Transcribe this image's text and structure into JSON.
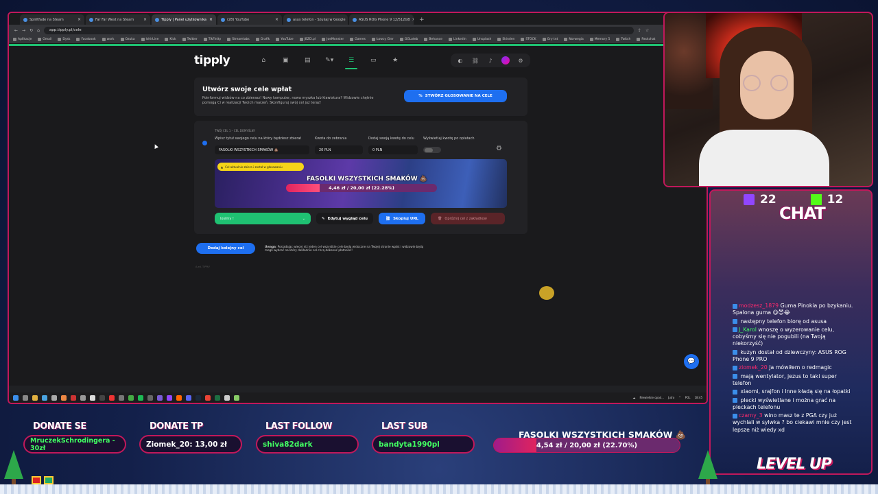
{
  "browser": {
    "tabs": [
      {
        "label": "Spiritfade na Steam",
        "active": false
      },
      {
        "label": "Far Far West na Steam",
        "active": false
      },
      {
        "label": "Tipply | Panel użytkownika",
        "active": true
      },
      {
        "label": "(28) YouTube",
        "active": false
      },
      {
        "label": "asus telefon - Szukaj w Google",
        "active": false
      },
      {
        "label": "ASUS ROG Phone 9 12/512GB",
        "active": false
      }
    ],
    "url": "app.tipply.pl/cele",
    "bookmarks": [
      "Aplikacje",
      "Gmail",
      "Dysk",
      "Facebook",
      "work",
      "Ozuka",
      "IshirLive",
      "Kick",
      "Twitter",
      "TikFinity",
      "Streamlabs",
      "Grafik",
      "YouTube",
      "JBZD.pl",
      "JoeMonster",
      "Games",
      "Łowcy Gier",
      "GGLoteb",
      "Behance",
      "Linkedin",
      "Unsplash",
      "Skinden",
      "STOCK",
      "Gry tnt",
      "Norwegia",
      "Memory 5",
      "Twitch",
      "Paskchat"
    ]
  },
  "tipply": {
    "logo": "tipply",
    "header_card": {
      "title": "Utwórz swoje cele wpłat",
      "description": "Poinformuj widzów na co zbierasz! Nowy komputer, nowa myszka lub klawiatura? Widzowie chętnie pomogą Ci w realizacji Twoich marzeń. Skonfiguruj swój cel już teraz!",
      "button": "STWÓRZ GŁOSOWANIE NA CELE"
    },
    "goal": {
      "subtitle": "TWÓJ CEL 1 – CEL DOMYŚLNY",
      "labels": {
        "title": "Wpisz tytuł swojego celu na który będziesz zbierał",
        "amount": "Kwota do zebrania",
        "add": "Dodaj swoją kwotę do celu",
        "show": "Wyświetlaj kwotę po opłatach"
      },
      "values": {
        "title": "FASOLKI WSZYSTKICH SMAKÓW 💩",
        "amount": "20 PLN",
        "add": "0 PLN"
      },
      "preview": {
        "warning": "Cel aktualnie zbiera i został w głosowaniu",
        "title": "FASOLKI WSZYSTKICH SMAKÓW 💩",
        "progress_text": "4,46 zł / 20,00 zł (22.28%)",
        "progress": 22.28
      },
      "select_value": "losimy !",
      "edit_button": "Edytuj wygląd celu",
      "copy_button": "Skopiuj URL",
      "delete_button": "Opróżnij cel z zakładkow"
    },
    "add_button": "Dodaj kolejny cel",
    "note_label": "Uwaga",
    "note": "Posiadając więcej niż jeden cel wszystkie cele będą widoczne na Twojej stronie wpłat i widzowie będą mogli wybrać na który dokładnie cel chcą dokonać płatności!",
    "footer": "A.ed. TIPPLY"
  },
  "taskbar": {
    "notice": "Niewielkie opad...",
    "notice_sub": "Jutro",
    "lang": "POL",
    "time": "18:45"
  },
  "overlay": {
    "twitch_count": "22",
    "kick_count": "12",
    "chat_title": "CHAT",
    "messages": [
      {
        "user": "modzesz_1879",
        "color": "",
        "text": "Guma Pinokia po bzykaniu. Spalona guma 😋😈😂"
      },
      {
        "user": "",
        "color": "b",
        "text": "następny telefon biorę od asusa"
      },
      {
        "user": "J_Karol",
        "color": "g",
        "text": "wnoszę o wyzerowanie celu, cobyśmy się nie pogubili (na Twoją niekorzyść)"
      },
      {
        "user": "",
        "color": "b",
        "text": "kuzyn dostał od dziewczyny: ASUS ROG Phone 9 PRO"
      },
      {
        "user": "ziomek_20",
        "color": "",
        "text": "Ja mówiłem o redmagic"
      },
      {
        "user": "",
        "color": "b",
        "text": "mają wentylator, jezus to taki super telefon"
      },
      {
        "user": "",
        "color": "b",
        "text": "xiaomi, srajfon i Inne kładą się na łopatki"
      },
      {
        "user": "",
        "color": "b",
        "text": "plecki wyświetlane i można grać na pleckach telefonu"
      },
      {
        "user": "czarny_3",
        "color": "",
        "text": "wino masz te z PGA czy już wychlali w sylwka ? bo ciekawi mnie czy jest lepsze niż wiedy xd"
      }
    ],
    "donate_se_label": "DONATE SE",
    "donate_se_value": "MruczekSchrodingera - 30zł",
    "donate_tp_label": "DONATE TP",
    "donate_tp_value": "Ziomek_20: 13,00 zł",
    "last_follow_label": "LAST FOLLOW",
    "last_follow_value": "shiva82dark",
    "last_sub_label": "LAST SUB",
    "last_sub_value": "bandyta1990pl",
    "goal_title": "FASOLKI WSZYSTKICH SMAKÓW 💩",
    "goal_text": "4,54 zł / 20,00 zł (22.70%)",
    "goal_progress": 22.7,
    "level_up": "LEVEL UP"
  }
}
